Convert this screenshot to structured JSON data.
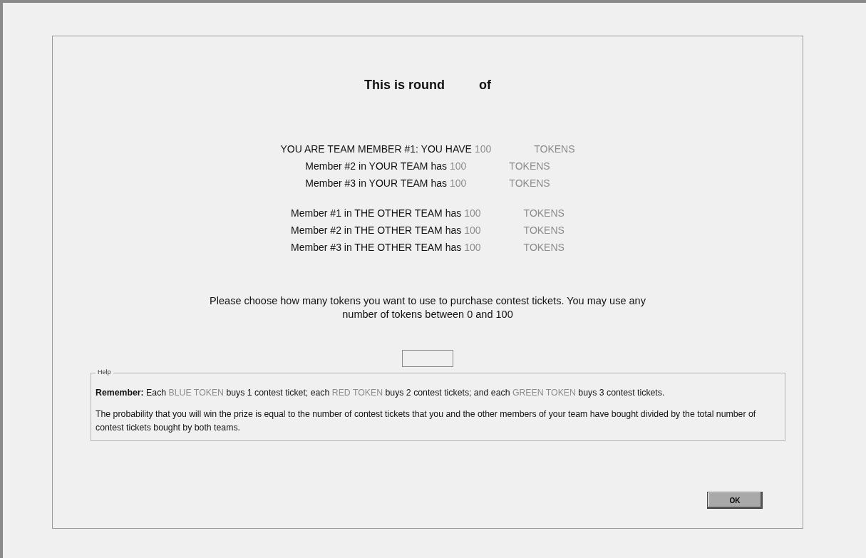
{
  "title": {
    "prefix": "This is round",
    "suffix": "of"
  },
  "your_team": [
    {
      "label": "YOU ARE TEAM MEMBER #1: YOU HAVE",
      "amount": "100",
      "unit": "TOKENS"
    },
    {
      "label": "Member #2 in YOUR TEAM has",
      "amount": "100",
      "unit": "TOKENS"
    },
    {
      "label": "Member #3 in YOUR TEAM has",
      "amount": "100",
      "unit": "TOKENS"
    }
  ],
  "other_team": [
    {
      "label": "Member #1 in THE OTHER TEAM has",
      "amount": "100",
      "unit": "TOKENS"
    },
    {
      "label": "Member #2 in THE OTHER TEAM has",
      "amount": "100",
      "unit": "TOKENS"
    },
    {
      "label": "Member #3 in THE OTHER TEAM has",
      "amount": "100",
      "unit": "TOKENS"
    }
  ],
  "instruction": "Please choose how many tokens you want to use to purchase contest tickets. You may use any number of tokens between 0 and 100",
  "help": {
    "legend": "Help",
    "paragraphs": [
      [
        {
          "kind": "bold",
          "text": "Remember:"
        },
        {
          "kind": "plain",
          "text": " Each "
        },
        {
          "kind": "token",
          "text": "BLUE TOKEN"
        },
        {
          "kind": "plain",
          "text": " buys 1 contest ticket; each "
        },
        {
          "kind": "token",
          "text": "RED TOKEN"
        },
        {
          "kind": "plain",
          "text": " buys 2 contest tickets; and each "
        },
        {
          "kind": "token",
          "text": "GREEN TOKEN"
        },
        {
          "kind": "plain",
          "text": " buys 3 contest tickets."
        }
      ],
      [
        {
          "kind": "plain",
          "text": "The probability that you will win the prize is equal to the number of contest tickets that you and the other members of your team have bought divided by the total number of contest tickets bought by both teams."
        }
      ]
    ]
  },
  "ok_button": "OK"
}
